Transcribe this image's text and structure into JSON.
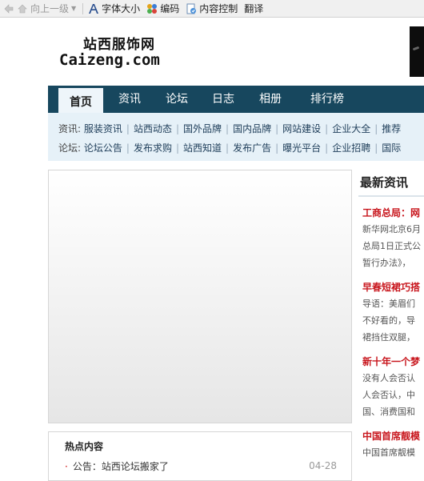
{
  "toolbar": {
    "back_label": "向上一级",
    "font_label": "字体大小",
    "encoding_label": "编码",
    "content_label": "内容控制",
    "translate_label": "翻译"
  },
  "logo": {
    "cn": "站西服饰网",
    "en": "Caizeng.com"
  },
  "nav": {
    "items": [
      "首页",
      "资讯",
      "论坛",
      "日志",
      "相册",
      "排行榜"
    ]
  },
  "subnav": {
    "news_label": "资讯:",
    "news_links": [
      "服装资讯",
      "站西动态",
      "国外品牌",
      "国内品牌",
      "网站建设",
      "企业大全",
      "推荐"
    ],
    "forum_label": "论坛:",
    "forum_links": [
      "论坛公告",
      "发布求购",
      "站西知道",
      "发布广告",
      "曝光平台",
      "企业招聘",
      "国际"
    ]
  },
  "hot": {
    "title": "热点内容",
    "items": [
      {
        "text": "公告：站西论坛搬家了",
        "date": "04-28"
      }
    ]
  },
  "latest": {
    "title": "最新资讯",
    "items": [
      {
        "title": "工商总局：网",
        "lines": [
          "新华网北京6月",
          "总局1日正式公",
          "暂行办法》，"
        ]
      },
      {
        "title": "早春短裙巧搭",
        "lines": [
          "导语：美眉们",
          "不好看的，导",
          "裙挡住双腿，"
        ]
      },
      {
        "title": "新十年一个梦",
        "lines": [
          "没有人会否认",
          "人会否认，中",
          "国、消费国和"
        ]
      },
      {
        "title": "中国首席靓模",
        "lines": [
          "中国首席靓模"
        ]
      }
    ]
  }
}
